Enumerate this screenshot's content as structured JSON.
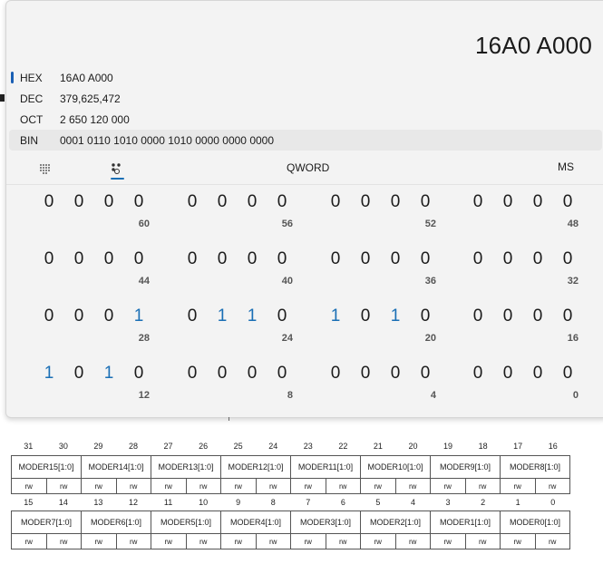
{
  "calculator": {
    "result": "16A0 A000",
    "radix": [
      {
        "label": "HEX",
        "value": "16A0 A000"
      },
      {
        "label": "DEC",
        "value": "379,625,472"
      },
      {
        "label": "OCT",
        "value": "2 650 120 000"
      },
      {
        "label": "BIN",
        "value": "0001 0110 1010 0000 1010 0000 0000 0000"
      }
    ],
    "toolbar": {
      "word_size": "QWORD",
      "memory": "MS"
    },
    "bit_rows": [
      {
        "groups": [
          [
            "0",
            "0",
            "0",
            "0"
          ],
          [
            "0",
            "0",
            "0",
            "0"
          ],
          [
            "0",
            "0",
            "0",
            "0"
          ],
          [
            "0",
            "0",
            "0",
            "0"
          ]
        ],
        "positions": [
          "60",
          "56",
          "52",
          "48"
        ]
      },
      {
        "groups": [
          [
            "0",
            "0",
            "0",
            "0"
          ],
          [
            "0",
            "0",
            "0",
            "0"
          ],
          [
            "0",
            "0",
            "0",
            "0"
          ],
          [
            "0",
            "0",
            "0",
            "0"
          ]
        ],
        "positions": [
          "44",
          "40",
          "36",
          "32"
        ]
      },
      {
        "groups": [
          [
            "0",
            "0",
            "0",
            "1"
          ],
          [
            "0",
            "1",
            "1",
            "0"
          ],
          [
            "1",
            "0",
            "1",
            "0"
          ],
          [
            "0",
            "0",
            "0",
            "0"
          ]
        ],
        "positions": [
          "28",
          "24",
          "20",
          "16"
        ]
      },
      {
        "groups": [
          [
            "1",
            "0",
            "1",
            "0"
          ],
          [
            "0",
            "0",
            "0",
            "0"
          ],
          [
            "0",
            "0",
            "0",
            "0"
          ],
          [
            "0",
            "0",
            "0",
            "0"
          ]
        ],
        "positions": [
          "12",
          "8",
          "4",
          "0"
        ]
      }
    ]
  },
  "register": {
    "upper_bits": [
      "31",
      "30",
      "29",
      "28",
      "27",
      "26",
      "25",
      "24",
      "23",
      "22",
      "21",
      "20",
      "19",
      "18",
      "17",
      "16"
    ],
    "upper_fields": [
      "MODER15[1:0]",
      "MODER14[1:0]",
      "MODER13[1:0]",
      "MODER12[1:0]",
      "MODER11[1:0]",
      "MODER10[1:0]",
      "MODER9[1:0]",
      "MODER8[1:0]"
    ],
    "lower_bits": [
      "15",
      "14",
      "13",
      "12",
      "11",
      "10",
      "9",
      "8",
      "7",
      "6",
      "5",
      "4",
      "3",
      "2",
      "1",
      "0"
    ],
    "lower_fields": [
      "MODER7[1:0]",
      "MODER6[1:0]",
      "MODER5[1:0]",
      "MODER4[1:0]",
      "MODER3[1:0]",
      "MODER2[1:0]",
      "MODER1[1:0]",
      "MODER0[1:0]"
    ],
    "access": "rw"
  }
}
